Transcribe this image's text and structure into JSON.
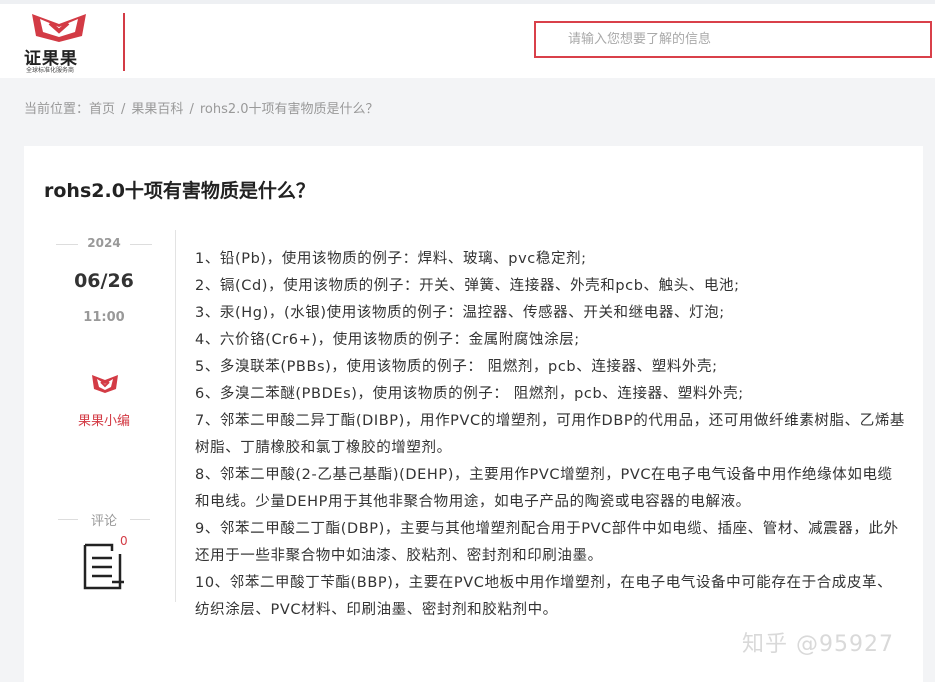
{
  "header": {
    "logo_text": "证果果",
    "logo_sub": "全球标准化服务商",
    "search_placeholder": "请输入您想要了解的信息"
  },
  "breadcrumb": {
    "prefix": "当前位置：",
    "items": [
      "首页",
      "果果百科",
      "rohs2.0十项有害物质是什么？"
    ]
  },
  "article": {
    "title": "rohs2.0十项有害物质是什么？",
    "year": "2024",
    "date": "06/26",
    "time": "11:00",
    "author": "果果小编",
    "comment_label": "评论",
    "comment_count": "0",
    "paragraphs": [
      "1、铅(Pb)，使用该物质的例子：焊料、玻璃、pvc稳定剂;",
      "2、镉(Cd)，使用该物质的例子：开关、弹簧、连接器、外壳和pcb、触头、电池;",
      "3、汞(Hg)，(水银)使用该物质的例子：温控器、传感器、开关和继电器、灯泡;",
      "4、六价铬(Cr6+)，使用该物质的例子：金属附腐蚀涂层;",
      "5、多溴联苯(PBBs)，使用该物质的例子： 阻燃剂，pcb、连接器、塑料外壳;",
      "6、多溴二苯醚(PBDEs)，使用该物质的例子： 阻燃剂，pcb、连接器、塑料外壳;",
      "7、邻苯二甲酸二异丁酯(DIBP)，用作PVC的增塑剂，可用作DBP的代用品，还可用做纤维素树脂、乙烯基树脂、丁腈橡胶和氯丁橡胶的增塑剂。",
      "8、邻苯二甲酸(2-乙基己基酯)(DEHP)，主要用作PVC增塑剂，PVC在电子电气设备中用作绝缘体如电缆和电线。少量DEHP用于其他非聚合物用途，如电子产品的陶瓷或电容器的电解液。",
      "9、邻苯二甲酸二丁酯(DBP)，主要与其他增塑剂配合用于PVC部件中如电缆、插座、管材、减震器，此外还用于一些非聚合物中如油漆、胶粘剂、密封剂和印刷油墨。",
      "10、邻苯二甲酸丁苄酯(BBP)，主要在PVC地板中用作增塑剂，在电子电气设备中可能存在于合成皮革、纺织涂层、PVC材料、印刷油墨、密封剂和胶粘剂中。"
    ]
  },
  "watermark": "知乎 @95927",
  "colors": {
    "accent": "#d33b45",
    "background": "#f3f4f6"
  }
}
